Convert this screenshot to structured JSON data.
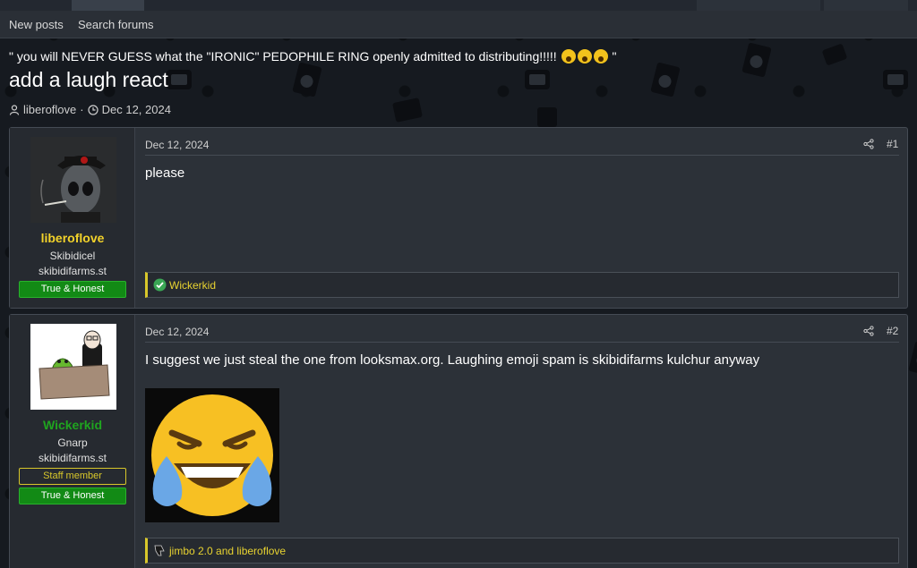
{
  "nav": {
    "new_posts": "New posts",
    "search_forums": "Search forums"
  },
  "thread": {
    "prefix": "\" you will NEVER GUESS what the \"IRONIC\" PEDOPHILE RING openly admitted to distributing!!!!!",
    "prefix_end": "\"",
    "title": "add a laugh react",
    "starter": "libero​flove",
    "sep": "·",
    "date": "Dec 12, 2024"
  },
  "posts": [
    {
      "username": "liberoflove",
      "username_color": "#f2d22a",
      "title": "Skibidicel",
      "site": "skibidifarms.st",
      "badges": [
        "True & Honest"
      ],
      "date": "Dec 12, 2024",
      "number": "#1",
      "body": "please",
      "reactions": "Wickerkid",
      "reaction_icon": "check-circle-icon"
    },
    {
      "username": "Wickerkid",
      "username_color": "#1fa51f",
      "title": "Gnarp",
      "site": "skibidifarms.st",
      "badges": [
        "Staff member",
        "True & Honest"
      ],
      "date": "Dec 12, 2024",
      "number": "#2",
      "body": "I suggest we just steal the one from looksmax.org. Laughing emoji spam is skibidifarms kulchur anyway",
      "reactions": "jimbo 2.0 and liberoflove",
      "reaction_icon": "thumbs-down-icon"
    }
  ],
  "colors": {
    "accent": "#d8c72a",
    "badge_green": "#128a15"
  }
}
